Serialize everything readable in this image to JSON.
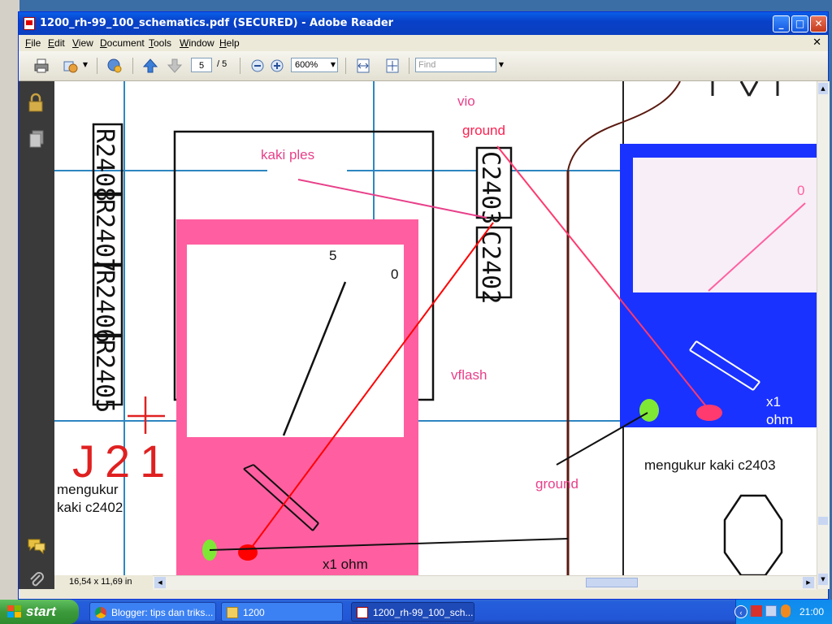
{
  "window": {
    "title": "1200_rh-99_100_schematics.pdf (SECURED) - Adobe Reader",
    "controls": {
      "minimize": "_",
      "maximize": "□",
      "close": "✕"
    }
  },
  "menu": [
    "File",
    "Edit",
    "View",
    "Document",
    "Tools",
    "Window",
    "Help"
  ],
  "toolbar": {
    "page_current": "5",
    "page_total": "/ 5",
    "zoom": "600%",
    "find_placeholder": "Find"
  },
  "status": {
    "page_size": "16,54 x 11,69 in"
  },
  "schematic": {
    "resistors": [
      "R2408",
      "R2407",
      "R2406",
      "R2405"
    ],
    "capacitors": [
      "C2403",
      "C2402"
    ],
    "connector": "J215",
    "labels": {
      "vio": "vio",
      "ground_top": "ground",
      "kaki_ples": "kaki ples",
      "vflash": "vflash",
      "ground_bottom": "ground"
    },
    "meter_left": {
      "scale_5": "5",
      "scale_0": "0",
      "range": "x1 ohm",
      "caption_line1": "mengukur",
      "caption_line2": "kaki c2402",
      "color": "#ff5fa0"
    },
    "meter_right": {
      "scale_0": "0",
      "range_line1": "x1",
      "range_line2": "ohm",
      "caption": "mengukur kaki c2403",
      "color": "#1a32ff"
    },
    "colors": {
      "grid": "#2e86c1",
      "probe_red": "#ff0000",
      "probe_green": "#7fe835",
      "annotation_pink": "#e8408a"
    }
  },
  "taskbar": {
    "start": "start",
    "tasks": [
      "Blogger: tips dan triks...",
      "1200",
      "1200_rh-99_100_sch..."
    ],
    "clock": "21:00"
  }
}
